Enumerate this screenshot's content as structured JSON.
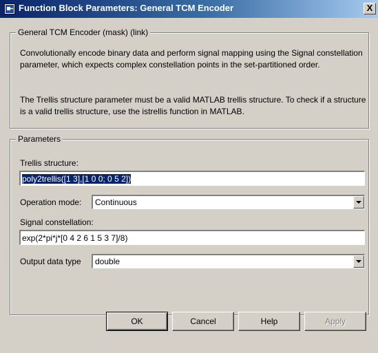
{
  "window": {
    "title": "Function Block Parameters: General TCM Encoder",
    "close_label": "X"
  },
  "mask": {
    "legend": "General TCM Encoder (mask) (link)",
    "description_1": "Convolutionally encode binary data and perform signal mapping using the Signal constellation parameter, which expects complex constellation points in the set-partitioned order.",
    "description_2": "The Trellis structure parameter must be a valid MATLAB trellis structure. To check if a structure is a valid trellis structure, use the istrellis function in MATLAB."
  },
  "parameters": {
    "legend": "Parameters",
    "trellis_label": "Trellis structure:",
    "trellis_value": "poly2trellis([1 3],[1 0 0; 0 5 2])",
    "operation_mode_label": "Operation mode:",
    "operation_mode_value": "Continuous",
    "constellation_label": "Signal constellation:",
    "constellation_value": "exp(2*pi*j*[0 4 2 6 1 5 3 7]/8)",
    "output_type_label": "Output data type",
    "output_type_value": "double"
  },
  "buttons": {
    "ok": "OK",
    "cancel": "Cancel",
    "help": "Help",
    "apply": "Apply"
  }
}
